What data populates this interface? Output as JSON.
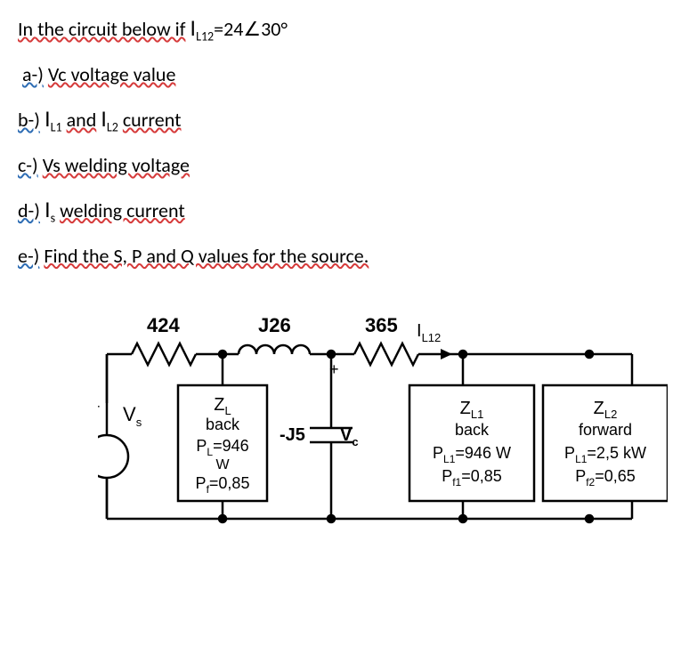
{
  "intro": "In the circuit below if",
  "intro_var": "I",
  "intro_sub": "L12",
  "intro_val": "=24∠30°",
  "parts": {
    "a_prefix": "a-)",
    "a_text": "Vc voltage value",
    "b_prefix": "b-)",
    "b_text1": "I",
    "b_sub1": "L1",
    "b_mid": "and",
    "b_text2": "I",
    "b_sub2": "L2",
    "b_end": "current",
    "c_prefix": "c-)",
    "c_text": "Vs welding voltage",
    "d_prefix": "d-)",
    "d_text1": "I",
    "d_sub1": "s",
    "d_end": "welding current",
    "e_prefix": "e-)",
    "e_text": "Find the S, P and Q values for the source."
  },
  "labels": {
    "r1": "424",
    "l1": "J26",
    "r2": "365",
    "il12": "I",
    "il12_sub": "L12",
    "vs": "V",
    "vs_sub": "s",
    "cap": "-J5",
    "vc": "V",
    "vc_sub": "c",
    "plus": "+"
  },
  "loadL": {
    "z": "Z",
    "z_sub": "L",
    "dir": "back",
    "p": "P",
    "p_sub": "L",
    "p_val": "=946",
    "p_unit": "W",
    "pf": "P",
    "pf_sub": "f",
    "pf_val": "=0,85"
  },
  "load1": {
    "z": "Z",
    "z_sub": "L1",
    "dir": "back",
    "p": "P",
    "p_sub": "L1",
    "p_val": "=946 W",
    "pf": "P",
    "pf_sub": "f1",
    "pf_val": "=0,85"
  },
  "load2": {
    "z": "Z",
    "z_sub": "L2",
    "dir": "forward",
    "p": "P",
    "p_sub": "L1",
    "p_val": "=2,5 kW",
    "pf": "P",
    "pf_sub": "f2",
    "pf_val": "=0,65"
  }
}
